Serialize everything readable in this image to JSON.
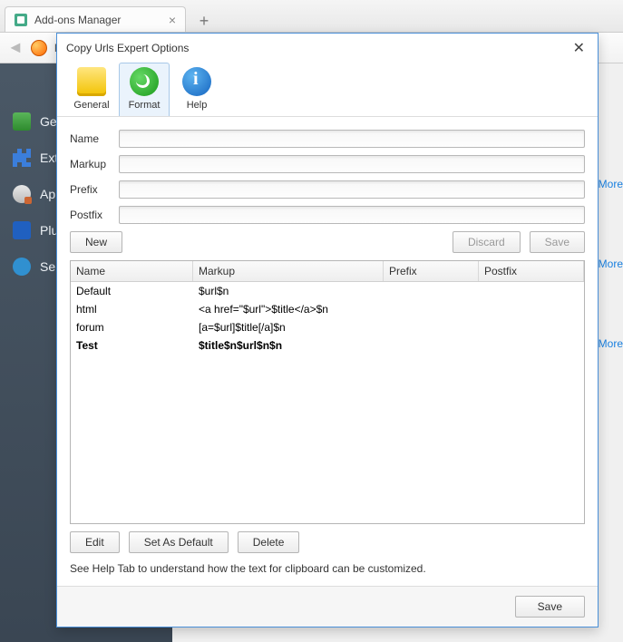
{
  "browser": {
    "tab_title": "Add-ons Manager",
    "new_tab": "+",
    "url_prefix": "F"
  },
  "addons_sidebar": {
    "items": [
      "Ge",
      "Ext",
      "Ap",
      "Plu",
      "Ser"
    ]
  },
  "right_links": [
    "More",
    "More",
    "More"
  ],
  "dialog": {
    "title": "Copy Urls Expert Options",
    "tabs": {
      "general": "General",
      "format": "Format",
      "help": "Help"
    },
    "labels": {
      "name": "Name",
      "markup": "Markup",
      "prefix": "Prefix",
      "postfix": "Postfix"
    },
    "buttons": {
      "new": "New",
      "discard": "Discard",
      "save_row": "Save",
      "edit": "Edit",
      "set_default": "Set As Default",
      "delete": "Delete",
      "save": "Save"
    },
    "columns": {
      "name": "Name",
      "markup": "Markup",
      "prefix": "Prefix",
      "postfix": "Postfix"
    },
    "rows": [
      {
        "name": "Default",
        "markup": "$url$n",
        "prefix": "",
        "postfix": "",
        "bold": false
      },
      {
        "name": "html",
        "markup": "<a href=\"$url\">$title</a>$n",
        "prefix": "",
        "postfix": "",
        "bold": false
      },
      {
        "name": "forum",
        "markup": "[a=$url]$title[/a]$n",
        "prefix": "",
        "postfix": "",
        "bold": false
      },
      {
        "name": "Test",
        "markup": "$title$n$url$n$n",
        "prefix": "",
        "postfix": "",
        "bold": true
      }
    ],
    "help_text": "See Help Tab to understand how the text for clipboard can be customized."
  }
}
